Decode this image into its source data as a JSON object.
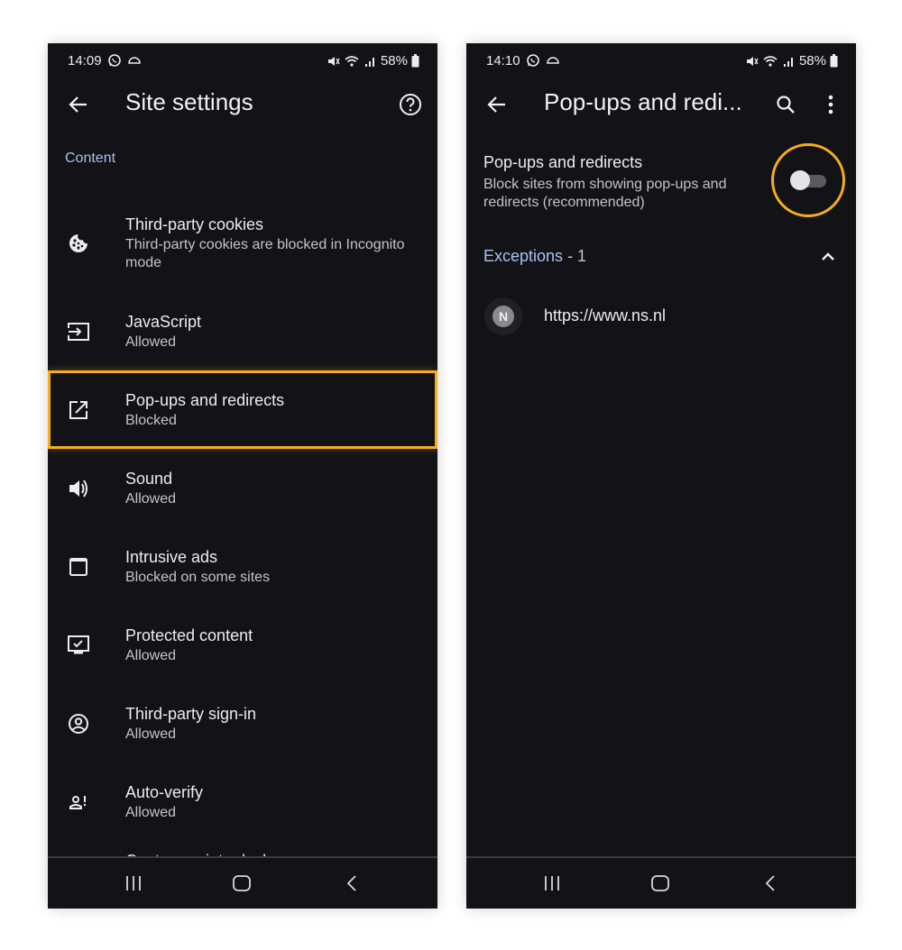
{
  "colors": {
    "background": "#131317",
    "accent_blue": "#a8c1f1",
    "highlight": "#f6ae1c",
    "text_primary": "#ececef",
    "text_secondary": "#c3c3c8"
  },
  "left_screen": {
    "status_bar": {
      "time": "14:09",
      "left_icons": [
        "whatsapp-icon",
        "cloud-icon"
      ],
      "right_icons": [
        "mute-icon",
        "wifi-icon",
        "signal-icon",
        "battery-icon"
      ],
      "battery": "58%"
    },
    "app_bar": {
      "title": "Site settings",
      "back_icon": "back-arrow-icon",
      "action_icon": "help-icon"
    },
    "section_header": "Content",
    "items": [
      {
        "title": "Third-party cookies",
        "subtitle": "Third-party cookies are blocked in Incognito mode",
        "icon": "cookie-icon",
        "highlighted": false
      },
      {
        "title": "JavaScript",
        "subtitle": "Allowed",
        "icon": "javascript-icon",
        "highlighted": false
      },
      {
        "title": "Pop-ups and redirects",
        "subtitle": "Blocked",
        "icon": "open-in-new-icon",
        "highlighted": true
      },
      {
        "title": "Sound",
        "subtitle": "Allowed",
        "icon": "volume-icon",
        "highlighted": false
      },
      {
        "title": "Intrusive ads",
        "subtitle": "Blocked on some sites",
        "icon": "window-icon",
        "highlighted": false
      },
      {
        "title": "Protected content",
        "subtitle": "Allowed",
        "icon": "protected-content-icon",
        "highlighted": false
      },
      {
        "title": "Third-party sign-in",
        "subtitle": "Allowed",
        "icon": "account-circle-icon",
        "highlighted": false
      },
      {
        "title": "Auto-verify",
        "subtitle": "Allowed",
        "icon": "auto-verify-icon",
        "highlighted": false
      }
    ],
    "cutoff_item": "Capture pointer lock",
    "nav_bar": [
      "recent-apps",
      "home",
      "back"
    ]
  },
  "right_screen": {
    "status_bar": {
      "time": "14:10",
      "left_icons": [
        "whatsapp-icon",
        "cloud-icon"
      ],
      "right_icons": [
        "mute-icon",
        "wifi-icon",
        "signal-icon",
        "battery-icon"
      ],
      "battery": "58%"
    },
    "app_bar": {
      "title": "Pop-ups and redi...",
      "back_icon": "back-arrow-icon",
      "actions": [
        "search-icon",
        "more-vert-icon"
      ]
    },
    "setting": {
      "title": "Pop-ups and redirects",
      "description": "Block sites from showing pop-ups and redirects (recommended)",
      "toggle_on": false,
      "highlighted": true
    },
    "exceptions": {
      "label": "Exceptions",
      "count": " - 1",
      "expanded": true,
      "items": [
        {
          "favicon_letter": "N",
          "url": "https://www.ns.nl"
        }
      ]
    },
    "nav_bar": [
      "recent-apps",
      "home",
      "back"
    ]
  }
}
